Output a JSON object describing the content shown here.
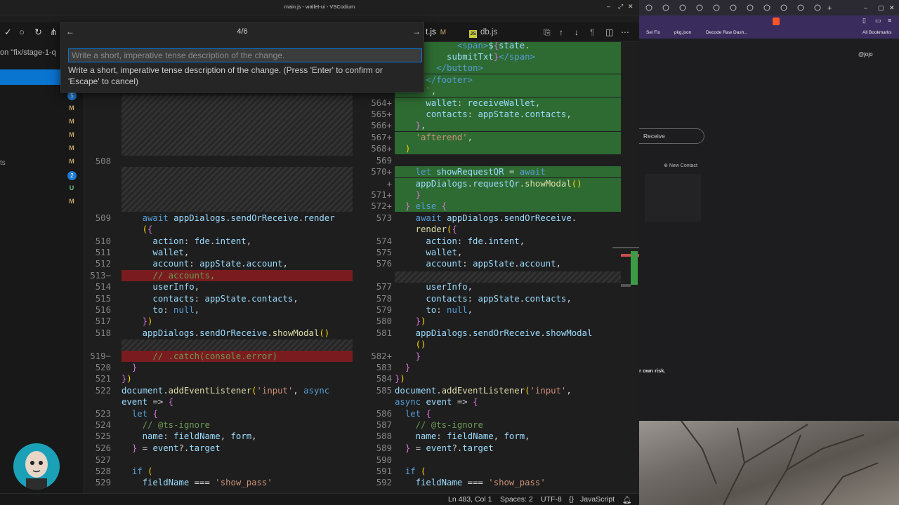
{
  "window": {
    "title": "main.js - wallet-ui - VSCodium"
  },
  "scm": {
    "branch": "on \"fix/stage-1-q",
    "letters": [
      "M",
      "M",
      "M",
      "M",
      "M",
      "U",
      "M"
    ],
    "badges": [
      "5",
      "2"
    ],
    "partial": "ts"
  },
  "tabs": [
    {
      "label": "t.js",
      "status": "M"
    },
    {
      "label": "db.js",
      "status": ""
    }
  ],
  "quick_input": {
    "step": "4/6",
    "placeholder": "Write a short, imperative tense description of the change.",
    "hint": "Write a short, imperative tense description of the change. (Press 'Enter' to confirm or 'Escape' to cancel)"
  },
  "status_bar": {
    "position": "Ln 483, Col 1",
    "spaces": "Spaces: 2",
    "encoding": "UTF-8",
    "language": "JavaScript"
  },
  "browser": {
    "bookmarks": [
      "Sel Fix",
      "pkg.json",
      "Decode Raw Dash...",
      "All Bookmarks"
    ],
    "handle": "@jojo",
    "receive_label": "Receive",
    "new_contact": "New Contact",
    "risk_text": "r own risk."
  },
  "left_lines": [
    {
      "n": "508",
      "t": "",
      "k": "blank"
    },
    {
      "n": "509",
      "t": "    await appDialogs.sendOrReceive.render"
    },
    {
      "n": "",
      "t": "    ({"
    },
    {
      "n": "510",
      "t": "      action: fde.intent,"
    },
    {
      "n": "511",
      "t": "      wallet,"
    },
    {
      "n": "512",
      "t": "      account: appState.account,"
    },
    {
      "n": "513−",
      "t": "      // accounts,",
      "k": "del"
    },
    {
      "n": "514",
      "t": "      userInfo,"
    },
    {
      "n": "515",
      "t": "      contacts: appState.contacts,"
    },
    {
      "n": "516",
      "t": "      to: null,"
    },
    {
      "n": "517",
      "t": "    })"
    },
    {
      "n": "518",
      "t": "    appDialogs.sendOrReceive.showModal()"
    },
    {
      "n": "519−",
      "t": "      // .catch(console.error)",
      "k": "del"
    },
    {
      "n": "520",
      "t": "  }"
    },
    {
      "n": "521",
      "t": "})"
    },
    {
      "n": "522",
      "t": "document.addEventListener('input', async"
    },
    {
      "n": "",
      "t": "event => {"
    },
    {
      "n": "523",
      "t": "  let {"
    },
    {
      "n": "524",
      "t": "    // @ts-ignore"
    },
    {
      "n": "525",
      "t": "    name: fieldName, form,"
    },
    {
      "n": "526",
      "t": "  } = event?.target"
    },
    {
      "n": "527",
      "t": ""
    },
    {
      "n": "528",
      "t": "  if ("
    },
    {
      "n": "529",
      "t": "    fieldName === 'show_pass'"
    }
  ],
  "right_lines": [
    {
      "n": "",
      "t": "            <span>${state.",
      "k": "ins"
    },
    {
      "n": "",
      "t": "          submitTxt}</span>",
      "k": "ins"
    },
    {
      "n": "",
      "t": "        </button>",
      "k": "ins"
    },
    {
      "n": "",
      "t": "      </footer>",
      "k": "ins"
    },
    {
      "n": "",
      "t": "      `,",
      "k": "ins"
    },
    {
      "n": "564+",
      "t": "      wallet: receiveWallet,",
      "k": "ins"
    },
    {
      "n": "565+",
      "t": "      contacts: appState.contacts,",
      "k": "ins"
    },
    {
      "n": "566+",
      "t": "    },",
      "k": "ins"
    },
    {
      "n": "567+",
      "t": "    'afterend',",
      "k": "ins"
    },
    {
      "n": "568+",
      "t": "  )",
      "k": "ins"
    },
    {
      "n": "569",
      "t": ""
    },
    {
      "n": "570+",
      "t": "    let showRequestQR = await",
      "k": "ins"
    },
    {
      "n": "+",
      "t": "    appDialogs.requestQr.showModal()",
      "k": "ins"
    },
    {
      "n": "571+",
      "t": "    }",
      "k": "ins"
    },
    {
      "n": "572+",
      "t": "  } else {",
      "k": "ins"
    },
    {
      "n": "573",
      "t": "    await appDialogs.sendOrReceive."
    },
    {
      "n": "",
      "t": "    render({"
    },
    {
      "n": "574",
      "t": "      action: fde.intent,"
    },
    {
      "n": "575",
      "t": "      wallet,"
    },
    {
      "n": "576",
      "t": "      account: appState.account,"
    },
    {
      "n": "577",
      "t": "      userInfo,"
    },
    {
      "n": "578",
      "t": "      contacts: appState.contacts,"
    },
    {
      "n": "579",
      "t": "      to: null,"
    },
    {
      "n": "580",
      "t": "    })"
    },
    {
      "n": "581",
      "t": "    appDialogs.sendOrReceive.showModal"
    },
    {
      "n": "",
      "t": "    ()"
    },
    {
      "n": "582+",
      "t": "    }"
    },
    {
      "n": "583",
      "t": "  }"
    },
    {
      "n": "584",
      "t": "})"
    },
    {
      "n": "585",
      "t": "document.addEventListener('input',"
    },
    {
      "n": "",
      "t": "async event => {"
    },
    {
      "n": "586",
      "t": "  let {"
    },
    {
      "n": "587",
      "t": "    // @ts-ignore"
    },
    {
      "n": "588",
      "t": "    name: fieldName, form,"
    },
    {
      "n": "589",
      "t": "  } = event?.target"
    },
    {
      "n": "590",
      "t": ""
    },
    {
      "n": "591",
      "t": "  if ("
    },
    {
      "n": "592",
      "t": "    fieldName === 'show_pass'"
    }
  ]
}
